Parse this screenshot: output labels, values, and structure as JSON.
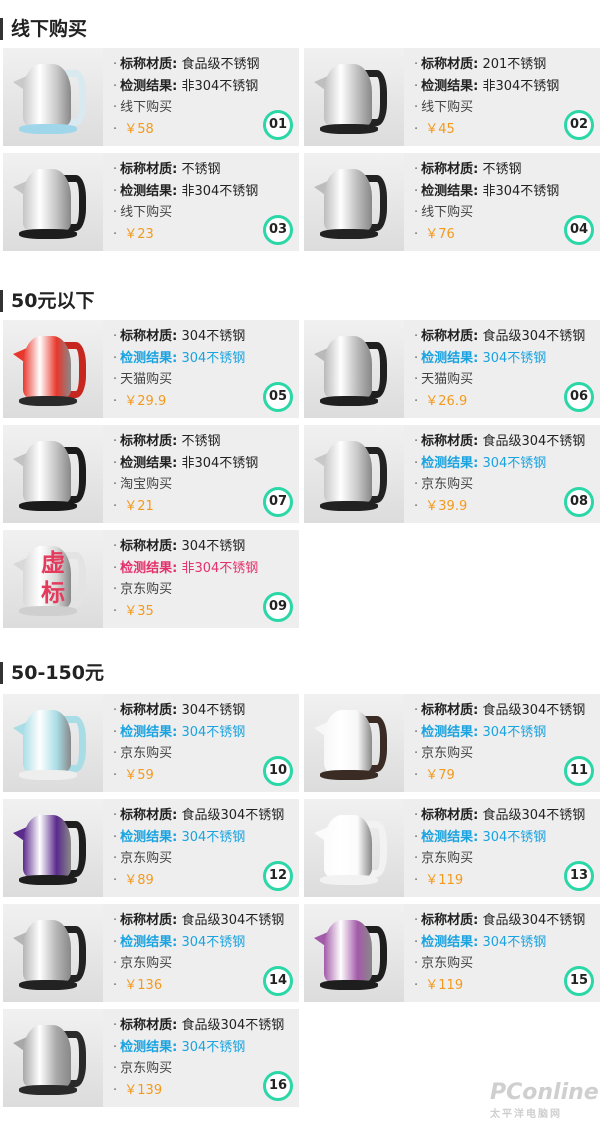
{
  "sections": [
    {
      "title": "线下购买"
    },
    {
      "title": "50元以下"
    },
    {
      "title": "50-150元"
    }
  ],
  "labels": {
    "material": "标称材质:",
    "result": "检测结果:"
  },
  "fake_stamp": "虚标",
  "watermark": {
    "brand": "PConline",
    "sub": "太平洋电脑网"
  },
  "colors": {
    "pass": "#19a3e0",
    "fail": "#e4306b",
    "price": "#f39a1e",
    "badge_ring": "#2bd6a7"
  },
  "products": [
    {
      "num": "01",
      "material": "食品级不锈钢",
      "result": "非304不锈钢",
      "buy": "线下购买",
      "price": "￥58",
      "status": "normal"
    },
    {
      "num": "02",
      "material": "201不锈钢",
      "result": "非304不锈钢",
      "buy": "线下购买",
      "price": "￥45",
      "status": "normal"
    },
    {
      "num": "03",
      "material": "不锈钢",
      "result": "非304不锈钢",
      "buy": "线下购买",
      "price": "￥23",
      "status": "normal"
    },
    {
      "num": "04",
      "material": "不锈钢",
      "result": "非304不锈钢",
      "buy": "线下购买",
      "price": "￥76",
      "status": "normal"
    },
    {
      "num": "05",
      "material": "304不锈钢",
      "result": "304不锈钢",
      "buy": "天猫购买",
      "price": "￥29.9",
      "status": "pass"
    },
    {
      "num": "06",
      "material": "食品级304不锈钢",
      "result": "304不锈钢",
      "buy": "天猫购买",
      "price": "￥26.9",
      "status": "pass"
    },
    {
      "num": "07",
      "material": "不锈钢",
      "result": "非304不锈钢",
      "buy": "淘宝购买",
      "price": "￥21",
      "status": "normal"
    },
    {
      "num": "08",
      "material": "食品级304不锈钢",
      "result": "304不锈钢",
      "buy": "京东购买",
      "price": "￥39.9",
      "status": "pass"
    },
    {
      "num": "09",
      "material": "304不锈钢",
      "result": "非304不锈钢",
      "buy": "京东购买",
      "price": "￥35",
      "status": "fail"
    },
    {
      "num": "10",
      "material": "304不锈钢",
      "result": "304不锈钢",
      "buy": "京东购买",
      "price": "￥59",
      "status": "pass"
    },
    {
      "num": "11",
      "material": "食品级304不锈钢",
      "result": "304不锈钢",
      "buy": "京东购买",
      "price": "￥79",
      "status": "pass"
    },
    {
      "num": "12",
      "material": "食品级304不锈钢",
      "result": "304不锈钢",
      "buy": "京东购买",
      "price": "￥89",
      "status": "pass"
    },
    {
      "num": "13",
      "material": "食品级304不锈钢",
      "result": "304不锈钢",
      "buy": "京东购买",
      "price": "￥119",
      "status": "pass"
    },
    {
      "num": "14",
      "material": "食品级304不锈钢",
      "result": "304不锈钢",
      "buy": "京东购买",
      "price": "￥136",
      "status": "pass"
    },
    {
      "num": "15",
      "material": "食品级304不锈钢",
      "result": "304不锈钢",
      "buy": "京东购买",
      "price": "￥119",
      "status": "pass"
    },
    {
      "num": "16",
      "material": "食品级304不锈钢",
      "result": "304不锈钢",
      "buy": "京东购买",
      "price": "￥139",
      "status": "pass"
    }
  ]
}
